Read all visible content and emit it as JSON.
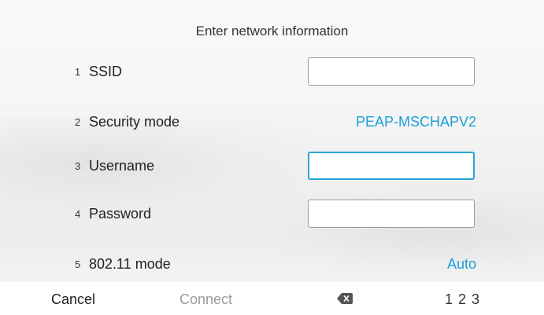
{
  "dialog": {
    "title": "Enter network information"
  },
  "fields": [
    {
      "number": "1",
      "label": "SSID",
      "value": "",
      "focused": false
    },
    {
      "number": "2",
      "label": "Security mode",
      "value": "PEAP-MSCHAPV2"
    },
    {
      "number": "3",
      "label": "Username",
      "value": "",
      "focused": true
    },
    {
      "number": "4",
      "label": "Password",
      "value": "",
      "focused": false
    },
    {
      "number": "5",
      "label": "802.11 mode",
      "value": "Auto"
    }
  ],
  "footer": {
    "cancel_label": "Cancel",
    "connect_label": "Connect",
    "backspace_icon": "backspace-icon",
    "numeric_label": "1 2 3"
  },
  "colors": {
    "accent": "#1a9fd8",
    "focus_border": "#2aa4d6",
    "disabled_text": "#9a9a9a"
  }
}
